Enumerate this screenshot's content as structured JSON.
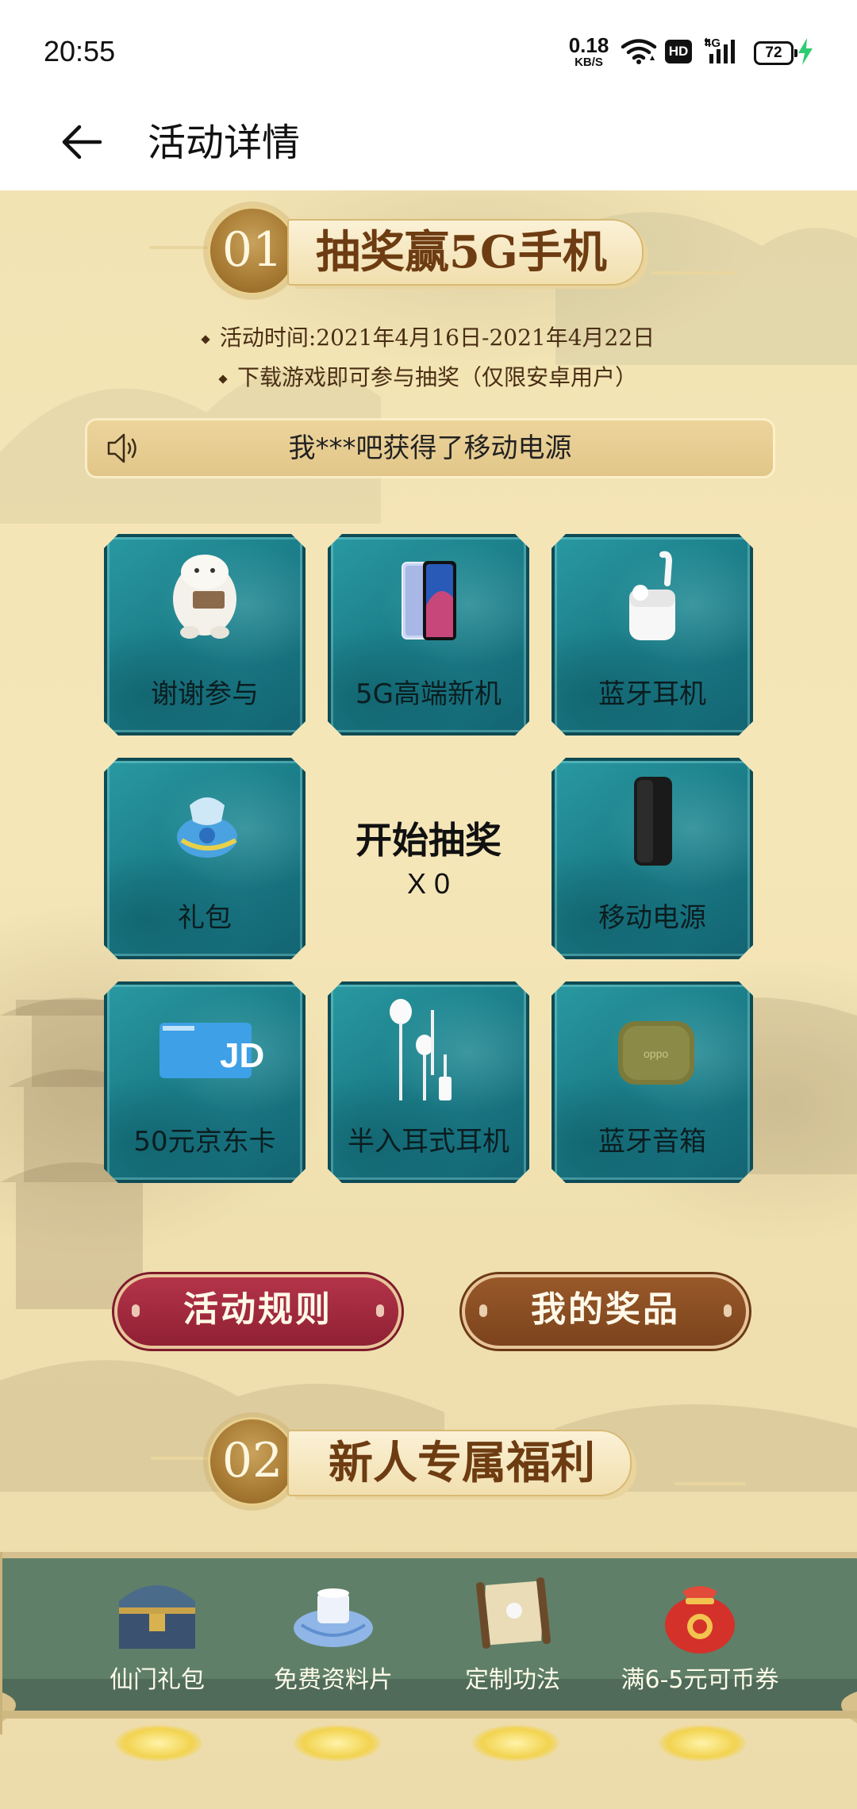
{
  "status_bar": {
    "time": "20:55",
    "net_speed_value": "0.18",
    "net_speed_unit": "KB/S",
    "hd_badge": "HD",
    "network_type": "4G",
    "battery_level": "72"
  },
  "header": {
    "title": "活动详情"
  },
  "section1": {
    "number": "01",
    "title": "抽奖赢5G手机",
    "time_text": "活动时间:2021年4月16日-2021年4月22日",
    "note_text": "下载游戏即可参与抽奖（仅限安卓用户）",
    "marquee_text": "我***吧获得了移动电源"
  },
  "prizes": [
    {
      "label": "谢谢参与",
      "icon": "thanks-mascot-icon"
    },
    {
      "label": "5G高端新机",
      "icon": "smartphone-icon"
    },
    {
      "label": "蓝牙耳机",
      "icon": "wireless-earbuds-icon"
    },
    {
      "label": "礼包",
      "icon": "gift-bag-icon"
    },
    {
      "label": "移动电源",
      "icon": "power-bank-icon"
    },
    {
      "label": "50元京东卡",
      "icon": "jd-card-icon"
    },
    {
      "label": "半入耳式耳机",
      "icon": "wired-earphones-icon"
    },
    {
      "label": "蓝牙音箱",
      "icon": "bluetooth-speaker-icon"
    }
  ],
  "draw": {
    "title": "开始抽奖",
    "count": "X 0"
  },
  "buttons": {
    "rules": "活动规则",
    "my_prizes": "我的奖品"
  },
  "section2": {
    "number": "02",
    "title": "新人专属福利",
    "benefits": [
      {
        "label": "仙门礼包",
        "icon": "treasure-chest-icon"
      },
      {
        "label": "免费资料片",
        "icon": "gift-box-icon"
      },
      {
        "label": "定制功法",
        "icon": "scroll-icon"
      },
      {
        "label": "满6-5元可币券",
        "icon": "lucky-bag-icon"
      }
    ]
  },
  "colors": {
    "page_bg": "#f2e3b3",
    "teal_cell": "#1b7e89",
    "rules_button": "#a12b40",
    "prizes_button": "#8a4e24",
    "title_brown": "#6e3c12",
    "band_green": "#5f7f68"
  }
}
